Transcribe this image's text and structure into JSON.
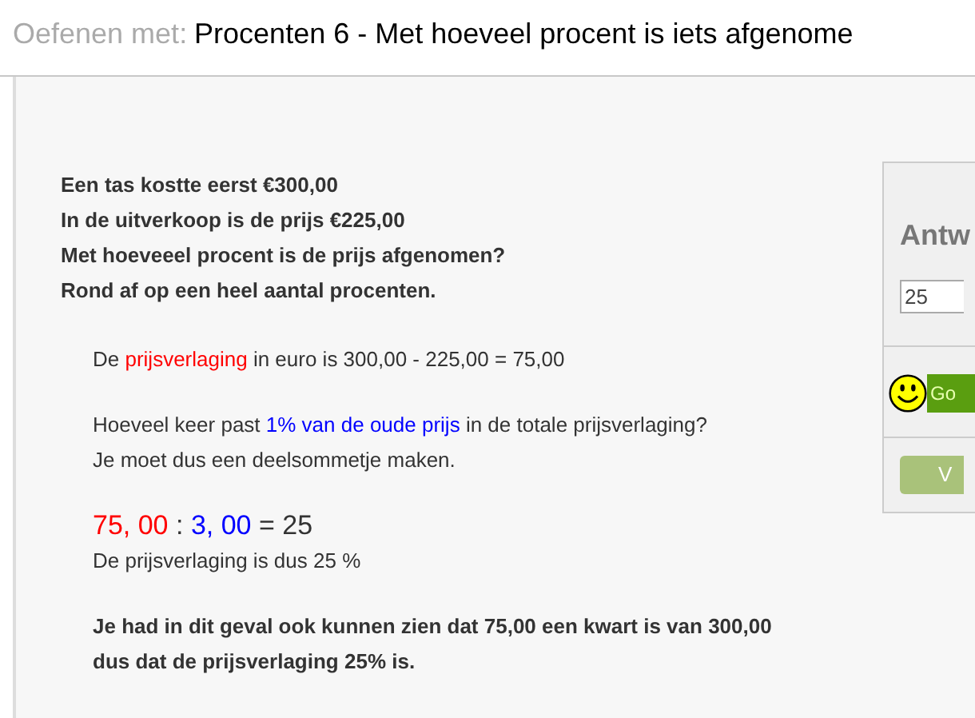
{
  "header": {
    "prefix": "Oefenen met:",
    "title": "Procenten 6 - Met hoeveel procent is iets afgenome"
  },
  "question": [
    "Een tas kostte eerst €300,00",
    "In de uitverkoop is de prijs €225,00",
    "Met hoeveeel procent is de prijs afgenomen?",
    "Rond af op een heel aantal procenten."
  ],
  "explanation": [
    [
      {
        "kind": "text",
        "parts": [
          {
            "text": "De "
          },
          {
            "text": "prijsverlaging",
            "color": "#ff0000"
          },
          {
            "text": " in euro is 300,00 - 225,00 = 75,00"
          }
        ]
      }
    ],
    [
      {
        "kind": "text",
        "parts": [
          {
            "text": "Hoeveel keer past "
          },
          {
            "text": "1% van de oude prijs",
            "color": "#0000ff"
          },
          {
            "text": " in de totale prijsverlaging?"
          }
        ]
      },
      {
        "kind": "text",
        "parts": [
          {
            "text": "Je moet dus een deelsommetje maken."
          }
        ]
      }
    ],
    [
      {
        "kind": "formula",
        "parts": [
          {
            "text": "75, 00",
            "color": "#ff0000"
          },
          {
            "text": " : "
          },
          {
            "text": "3, 00",
            "color": "#0000ff"
          },
          {
            "text": " = 25"
          }
        ]
      },
      {
        "kind": "text",
        "parts": [
          {
            "text": "De prijsverlaging is dus 25 %"
          }
        ]
      }
    ],
    [
      {
        "kind": "bold",
        "parts": [
          {
            "text": "Je had in dit geval ook kunnen zien dat 75,00 een kwart is van 300,00 dus dat de prijsverlaging 25% is."
          }
        ]
      }
    ]
  ],
  "answer": {
    "heading": "Antw",
    "value": "25",
    "check_button": "Go",
    "next_button": "V"
  }
}
